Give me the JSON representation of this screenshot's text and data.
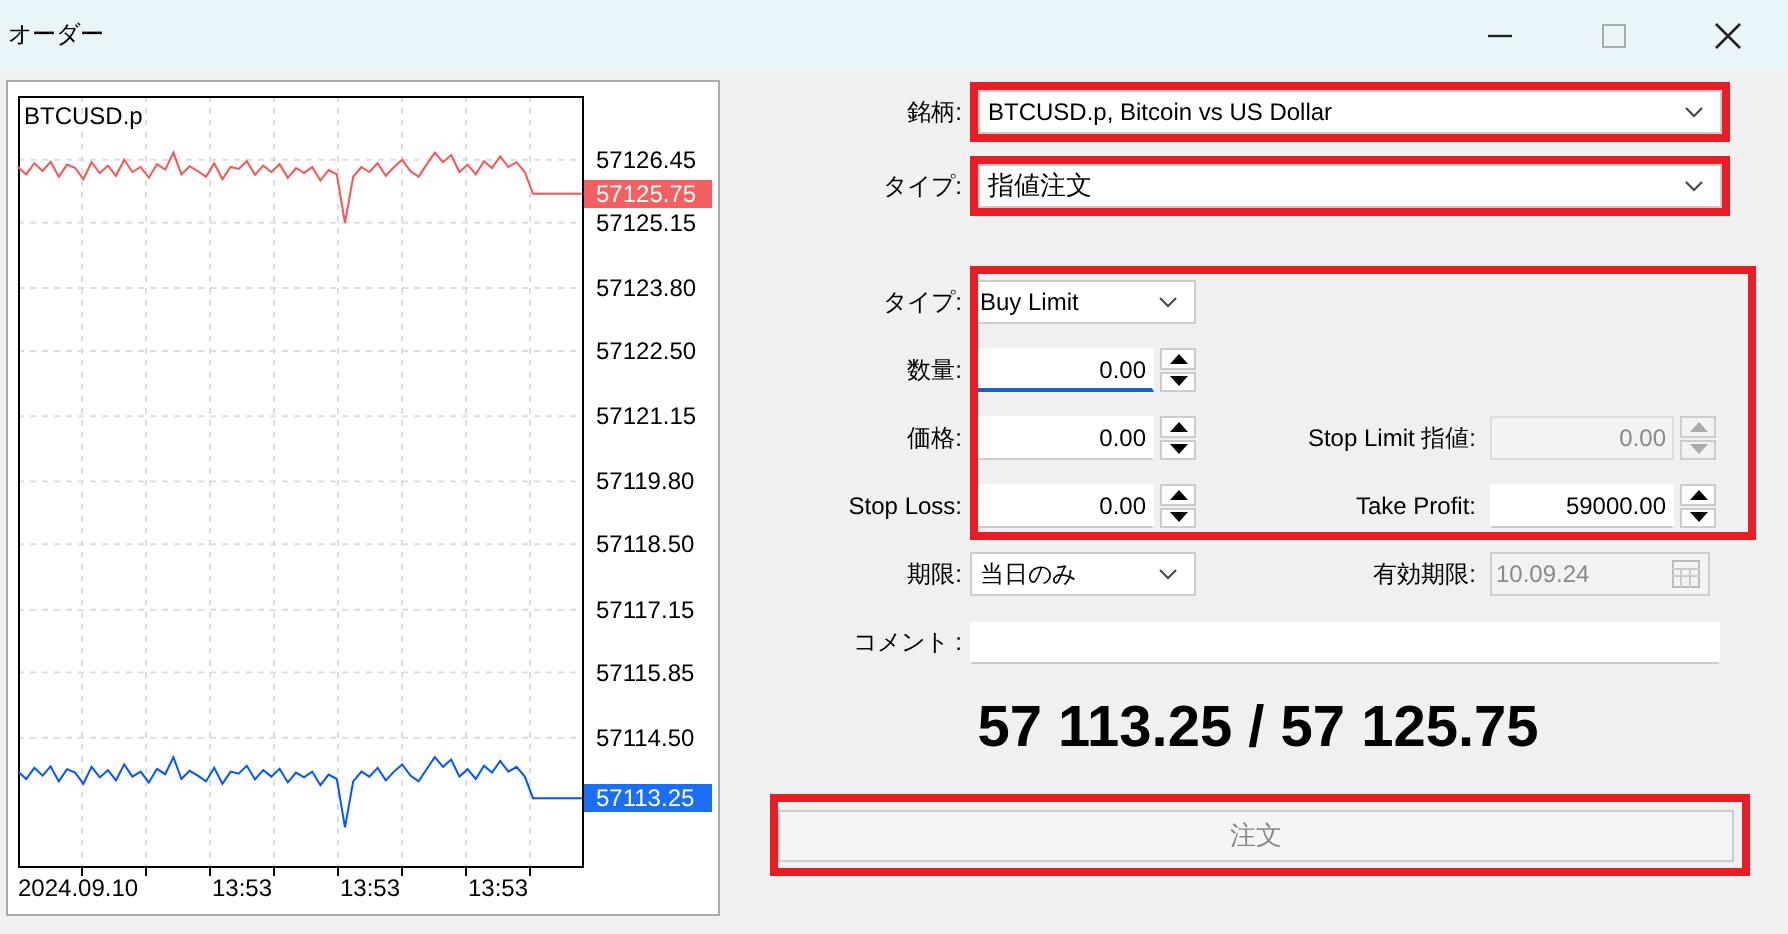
{
  "window": {
    "title": "オーダー"
  },
  "chart": {
    "symbol": "BTCUSD.p",
    "ask_tag": "57125.75",
    "bid_tag": "57113.25",
    "x_labels": [
      "2024.09.10",
      "13:53",
      "13:53",
      "13:53"
    ],
    "chart_data": {
      "type": "line",
      "grid": true,
      "ylim": [
        57111.85,
        57127.77
      ],
      "yticks": [
        {
          "value": 57126.45,
          "label": "57126.45"
        },
        {
          "value": 57125.15,
          "label": "57125.15"
        },
        {
          "value": 57123.8,
          "label": "57123.80"
        },
        {
          "value": 57122.5,
          "label": "57122.50"
        },
        {
          "value": 57121.15,
          "label": "57121.15"
        },
        {
          "value": 57119.8,
          "label": "57119.80"
        },
        {
          "value": 57118.5,
          "label": "57118.50"
        },
        {
          "value": 57117.15,
          "label": "57117.15"
        },
        {
          "value": 57115.85,
          "label": "57115.85"
        },
        {
          "value": 57114.5,
          "label": "57114.50"
        }
      ],
      "series": [
        {
          "color": "#f55555",
          "values": [
            57126.3,
            57126.15,
            57126.38,
            57126.22,
            57126.41,
            57126.1,
            57126.35,
            57126.28,
            57126.05,
            57126.4,
            57126.18,
            57126.33,
            57126.12,
            57126.45,
            57126.2,
            57126.3,
            57126.08,
            57126.36,
            57126.25,
            57126.6,
            57126.15,
            57126.32,
            57126.22,
            57126.1,
            57126.38,
            57126.05,
            57126.3,
            57126.26,
            57126.42,
            57126.14,
            57126.33,
            57126.2,
            57126.36,
            57126.08,
            57126.28,
            57126.18,
            57126.3,
            57126.02,
            57126.24,
            57126.15,
            57125.15,
            57126.1,
            57126.3,
            57126.2,
            57126.38,
            57126.12,
            57126.3,
            57126.45,
            57126.22,
            57126.1,
            57126.35,
            57126.6,
            57126.4,
            57126.55,
            57126.2,
            57126.35,
            57126.15,
            57126.42,
            57126.28,
            57126.52,
            57126.3,
            57126.4,
            57126.2,
            57125.75,
            57125.75,
            57125.75,
            57125.75,
            57125.75,
            57125.75,
            57125.75
          ]
        },
        {
          "color": "#0055ff",
          "values": [
            57113.8,
            57113.65,
            57113.88,
            57113.72,
            57113.91,
            57113.6,
            57113.85,
            57113.78,
            57113.55,
            57113.9,
            57113.68,
            57113.83,
            57113.62,
            57113.95,
            57113.7,
            57113.8,
            57113.58,
            57113.86,
            57113.75,
            57114.1,
            57113.65,
            57113.82,
            57113.72,
            57113.6,
            57113.88,
            57113.55,
            57113.8,
            57113.76,
            57113.92,
            57113.64,
            57113.83,
            57113.7,
            57113.86,
            57113.58,
            57113.78,
            57113.68,
            57113.8,
            57113.52,
            57113.74,
            57113.65,
            57112.65,
            57113.6,
            57113.8,
            57113.7,
            57113.88,
            57113.62,
            57113.8,
            57113.95,
            57113.72,
            57113.6,
            57113.85,
            57114.1,
            57113.9,
            57114.05,
            57113.7,
            57113.85,
            57113.65,
            57113.92,
            57113.78,
            57114.02,
            57113.8,
            57113.9,
            57113.7,
            57113.25,
            57113.25,
            57113.25,
            57113.25,
            57113.25,
            57113.25,
            57113.25
          ]
        }
      ]
    }
  },
  "symbol": {
    "label": "銘柄:",
    "value": "BTCUSD.p, Bitcoin vs US Dollar",
    "highlighted": true
  },
  "execution": {
    "label": "タイプ:",
    "value": "指値注文",
    "highlighted": true
  },
  "order": {
    "highlighted": true,
    "type": {
      "label": "タイプ:",
      "value": "Buy Limit"
    },
    "volume": {
      "label": "数量:",
      "value": "0.00",
      "focused": true
    },
    "price": {
      "label": "価格:",
      "value": "0.00",
      "focused": false
    },
    "stop_limit": {
      "label": "Stop Limit 指値:",
      "value": "0.00",
      "disabled": true
    },
    "stop_loss": {
      "label": "Stop Loss:",
      "value": "0.00",
      "focused": false
    },
    "take_profit": {
      "label": "Take Profit:",
      "value": "59000.00",
      "disabled": false
    }
  },
  "expiration": {
    "label": "期限:",
    "value": "当日のみ"
  },
  "expiry_date": {
    "label": "有効期限:",
    "value": "10.09.24",
    "disabled": true
  },
  "comment": {
    "label": "コメント :"
  },
  "quote": "57 113.25 / 57 125.75",
  "submit": {
    "label": "注文",
    "disabled": true,
    "highlighted": true
  }
}
